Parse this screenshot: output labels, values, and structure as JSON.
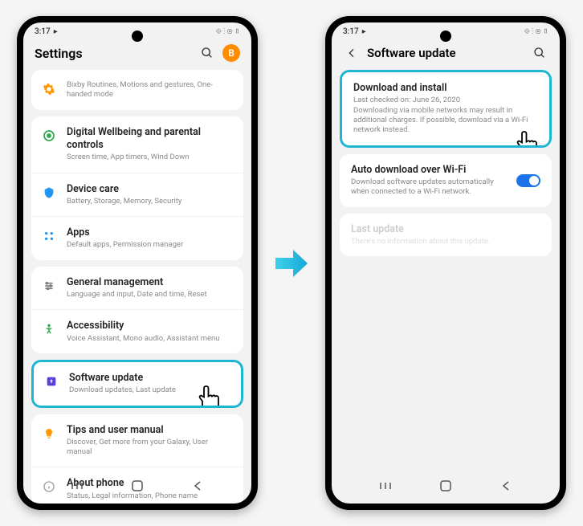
{
  "status": {
    "time": "3:17",
    "icons": "⟐ ⋮ ⊚ ▯"
  },
  "left": {
    "title": "Settings",
    "avatar": "B",
    "card0": {
      "title": "Bixby Routines, Motions and gestures, One-handed mode"
    },
    "items": [
      {
        "title": "Digital Wellbeing and parental controls",
        "sub": "Screen time, App timers, Wind Down",
        "icon": "wellbeing",
        "color": "#2ba84a"
      },
      {
        "title": "Device care",
        "sub": "Battery, Storage, Memory, Security",
        "icon": "device-care",
        "color": "#2196f3"
      },
      {
        "title": "Apps",
        "sub": "Default apps, Permission manager",
        "icon": "apps",
        "color": "#2196f3"
      },
      {
        "title": "General management",
        "sub": "Language and input, Date and time, Reset",
        "icon": "general",
        "color": "#7e7e7e"
      },
      {
        "title": "Accessibility",
        "sub": "Voice Assistant, Mono audio, Assistant menu",
        "icon": "accessibility",
        "color": "#2ba84a"
      },
      {
        "title": "Software update",
        "sub": "Download updates, Last update",
        "icon": "update",
        "color": "#5b3fd9"
      },
      {
        "title": "Tips and user manual",
        "sub": "Discover, Get more from your Galaxy, User manual",
        "icon": "tips",
        "color": "#ff9800"
      },
      {
        "title": "About phone",
        "sub": "Status, Legal information, Phone name",
        "icon": "about",
        "color": "#9e9e9e"
      }
    ]
  },
  "right": {
    "title": "Software update",
    "items": [
      {
        "title": "Download and install",
        "sub": "Last checked on: June 26, 2020\nDownloading via mobile networks may result in additional charges. If possible, download via a Wi-Fi network instead."
      },
      {
        "title": "Auto download over Wi-Fi",
        "sub": "Download software updates automatically when connected to a Wi-Fi network.",
        "toggle": true
      },
      {
        "title": "Last update",
        "sub": "There's no information about this update."
      }
    ]
  }
}
